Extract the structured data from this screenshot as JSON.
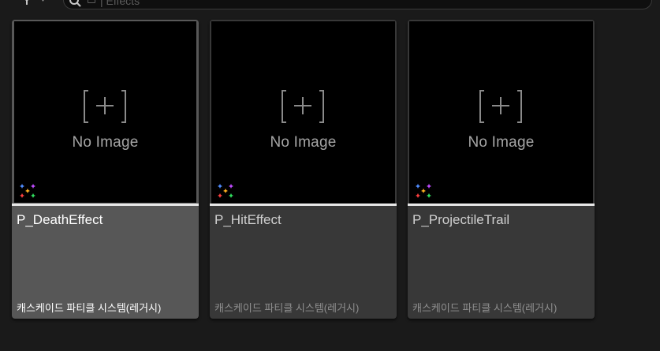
{
  "toolbar": {
    "filter_icon": "funnel-icon",
    "filter_caret": "▾",
    "search": {
      "path_text": "| Effects",
      "dropdown_caret": "▾",
      "icon": "search-icon"
    }
  },
  "assets": [
    {
      "name": "P_DeathEffect",
      "type_label": "캐스케이드 파티클 시스템(레거시)",
      "thumbnail_text": "No Image",
      "icon": "particle-system-icon",
      "selected": true
    },
    {
      "name": "P_HitEffect",
      "type_label": "캐스케이드 파티클 시스템(레거시)",
      "thumbnail_text": "No Image",
      "icon": "particle-system-icon",
      "selected": false
    },
    {
      "name": "P_ProjectileTrail",
      "type_label": "캐스케이드 파티클 시스템(레거시)",
      "thumbnail_text": "No Image",
      "icon": "particle-system-icon",
      "selected": false
    }
  ],
  "colors": {
    "background": "#1a1a1a",
    "tile": "#383838",
    "tile_selected": "#575757",
    "thumb": "#000000",
    "accent_rule": "#e8e8e8"
  }
}
